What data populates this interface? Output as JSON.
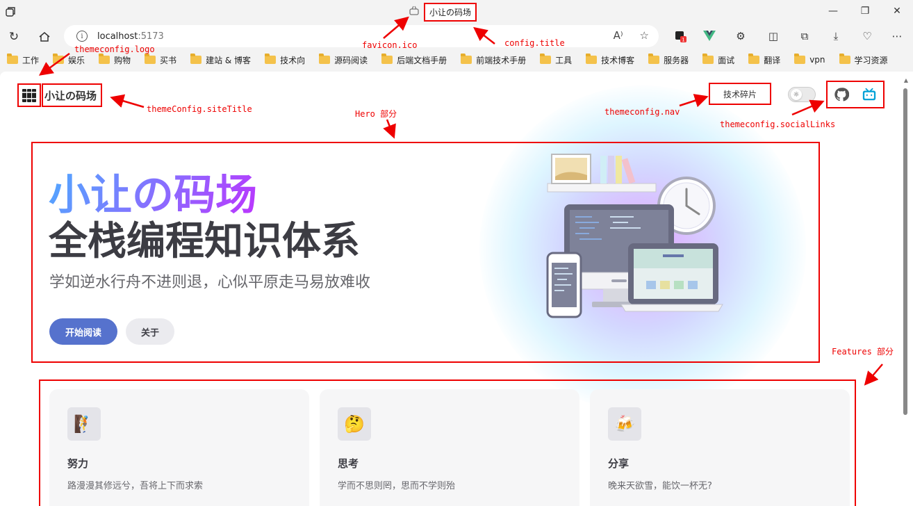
{
  "browser": {
    "tab_title": "小让の码场",
    "url_host": "localhost",
    "url_port": ":5173",
    "window_buttons": [
      "—",
      "❐",
      "✕"
    ],
    "extension_badge": "1",
    "bookmarks": [
      "工作",
      "娱乐",
      "购物",
      "买书",
      "建站 & 博客",
      "技术向",
      "源码阅读",
      "后端文档手册",
      "前端技术手册",
      "工具",
      "技术博客",
      "服务器",
      "面试",
      "翻译",
      "vpn",
      "学习资源"
    ]
  },
  "site": {
    "title": "小让の码场",
    "nav": [
      "技术碎片"
    ]
  },
  "hero": {
    "name": "小让の码场",
    "text": "全栈编程知识体系",
    "tagline": "学如逆水行舟不进则退，心似平原走马易放难收",
    "actions": [
      {
        "label": "开始阅读",
        "theme": "brand"
      },
      {
        "label": "关于",
        "theme": "alt"
      }
    ]
  },
  "features": [
    {
      "icon": "🧗",
      "title": "努力",
      "details": "路漫漫其修远兮，吾将上下而求索"
    },
    {
      "icon": "🤔",
      "title": "思考",
      "details": "学而不思则罔，思而不学则殆"
    },
    {
      "icon": "🍻",
      "title": "分享",
      "details": "晚来天欲雪，能饮一杯无?"
    }
  ],
  "annotations": {
    "favicon": "favicon.ico",
    "config_title": "config.title",
    "logo": "themeconfig.logo",
    "site_title": "themeConfig.siteTitle",
    "hero": "Hero 部分",
    "nav": "themeconfig.nav",
    "social": "themeconfig.socialLinks",
    "features": "Features 部分"
  },
  "colors": {
    "brand": "#5672cd",
    "annotation": "#ee0000",
    "hero_gradient_start": "#4fa9ff",
    "hero_gradient_end": "#bd34fe"
  }
}
